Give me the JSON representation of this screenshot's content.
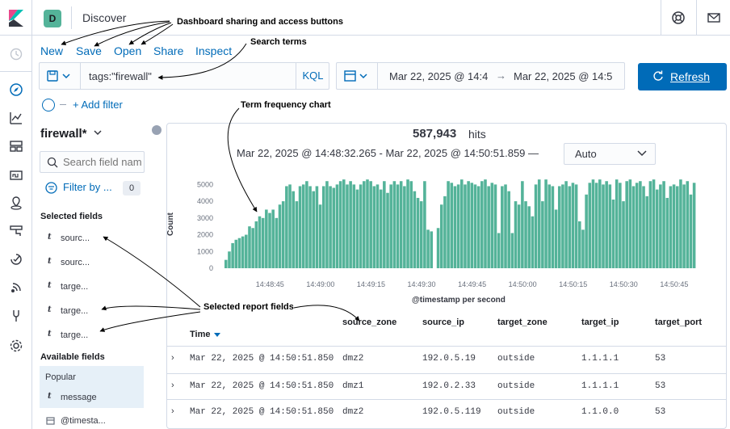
{
  "header": {
    "app_badge": "D",
    "title": "Discover"
  },
  "toolbar": {
    "new": "New",
    "save": "Save",
    "open": "Open",
    "share": "Share",
    "inspect": "Inspect"
  },
  "query": {
    "text": "tags:\"firewall\"",
    "language": "KQL"
  },
  "time": {
    "start": "Mar 22, 2025 @ 14:4",
    "arrow": "→",
    "end": "Mar 22, 2025 @ 14:5",
    "refresh": "Refresh"
  },
  "filters": {
    "add": "+ Add filter"
  },
  "sidebar": {
    "index": "firewall*",
    "search_placeholder": "Search field names",
    "filter_type": "Filter by ...",
    "filter_type_count": "0",
    "selected_header": "Selected fields",
    "selected": [
      {
        "type": "t",
        "name": "sourc..."
      },
      {
        "type": "t",
        "name": "sourc..."
      },
      {
        "type": "t",
        "name": "targe..."
      },
      {
        "type": "t",
        "name": "targe..."
      },
      {
        "type": "t",
        "name": "targe..."
      }
    ],
    "available_header": "Available fields",
    "popular_label": "Popular",
    "available": [
      {
        "type": "t",
        "name": "message"
      },
      {
        "type": "cal",
        "name": "@timesta..."
      }
    ]
  },
  "chart": {
    "hits": "587,943",
    "hits_label": "hits",
    "range": "Mar 22, 2025 @ 14:48:32.265 - Mar 22, 2025 @ 14:50:51.859 —",
    "interval": "Auto",
    "ylabel": "Count",
    "xlabel": "@timestamp per second"
  },
  "chart_data": {
    "type": "bar",
    "ylabel": "Count",
    "xlabel": "@timestamp per second",
    "ylim": [
      0,
      5500
    ],
    "yticks": [
      0,
      1000,
      2000,
      3000,
      4000,
      5000
    ],
    "xticks": [
      "14:48:45",
      "14:49:00",
      "14:49:15",
      "14:49:30",
      "14:49:45",
      "14:50:00",
      "14:50:15",
      "14:50:30",
      "14:50:45"
    ],
    "x_start_label": "14:48:32",
    "x_step_seconds": 1,
    "color": "#54b399",
    "values": [
      500,
      1000,
      1500,
      1700,
      1800,
      1900,
      2000,
      2500,
      2400,
      2800,
      3100,
      3000,
      3500,
      3300,
      3500,
      3000,
      3800,
      4000,
      4900,
      5000,
      4600,
      4000,
      4900,
      5000,
      5200,
      4900,
      4600,
      4900,
      3800,
      4900,
      5200,
      4900,
      4800,
      5000,
      5200,
      5300,
      5000,
      5200,
      5000,
      4700,
      5000,
      5200,
      5300,
      5200,
      4900,
      5000,
      4700,
      5200,
      4500,
      5000,
      5200,
      5000,
      5200,
      4900,
      5300,
      5200,
      4600,
      4200,
      4000,
      5200,
      2300,
      2200,
      0,
      2400,
      3800,
      4300,
      5200,
      5100,
      4900,
      5000,
      5300,
      5000,
      5200,
      5100,
      5000,
      4900,
      5200,
      5300,
      4900,
      5100,
      5000,
      2100,
      4900,
      5000,
      4600,
      2100,
      4000,
      3800,
      5200,
      4000,
      3700,
      3100,
      5000,
      5300,
      4000,
      5300,
      5000,
      4900,
      3500,
      4900,
      5000,
      5200,
      4900,
      5100,
      5000,
      2800,
      2300,
      4400,
      5100,
      5300,
      5100,
      5300,
      5000,
      5200,
      5000,
      4100,
      5300,
      5100,
      4000,
      5200,
      5300,
      4900,
      5100,
      5200,
      4900,
      4300,
      5200,
      5300,
      4700,
      5000,
      5200,
      4200,
      4900,
      5000,
      4900,
      5300,
      5000,
      5200,
      4400,
      5100
    ]
  },
  "table": {
    "columns": [
      "Time",
      "source_zone",
      "source_ip",
      "target_zone",
      "target_ip",
      "target_port"
    ],
    "rows": [
      [
        "Mar 22, 2025 @ 14:50:51.850",
        "dmz2",
        "192.0.5.19",
        "outside",
        "1.1.1.1",
        "53"
      ],
      [
        "Mar 22, 2025 @ 14:50:51.850",
        "dmz1",
        "192.0.2.33",
        "outside",
        "1.1.1.1",
        "53"
      ],
      [
        "Mar 22, 2025 @ 14:50:51.850",
        "dmz2",
        "192.0.5.119",
        "outside",
        "1.1.0.0",
        "53"
      ]
    ]
  },
  "annotations": {
    "sharing": "Dashboard sharing and access buttons",
    "search": "Search terms",
    "freq": "Term frequency chart",
    "report": "Selected report fields"
  }
}
